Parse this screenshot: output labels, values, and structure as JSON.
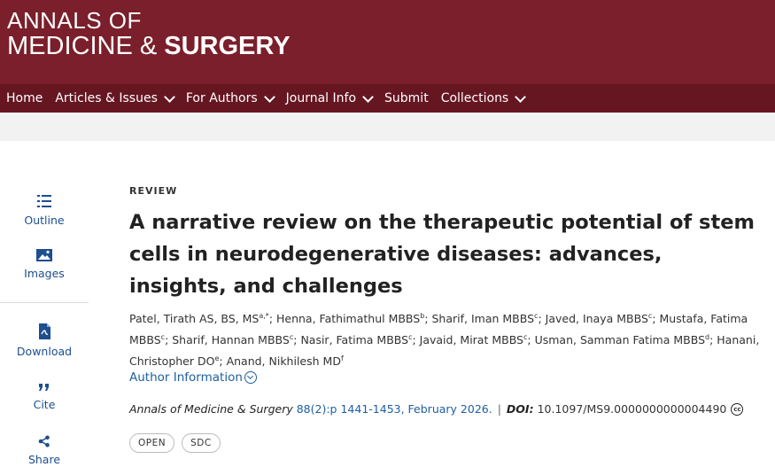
{
  "brand": {
    "line1": "ANNALS OF",
    "line2_pre": "MEDICINE & ",
    "line2_bold": "SURGERY",
    "colors": {
      "masthead": "#7a1f2b",
      "navbar": "#661621",
      "link": "#1d5fa3"
    }
  },
  "nav": [
    {
      "label": "Home",
      "dropdown": false
    },
    {
      "label": "Articles & Issues",
      "dropdown": true
    },
    {
      "label": "For Authors",
      "dropdown": true
    },
    {
      "label": "Journal Info",
      "dropdown": true
    },
    {
      "label": "Submit",
      "dropdown": false
    },
    {
      "label": "Collections",
      "dropdown": true
    }
  ],
  "sidebar": [
    {
      "label": "Outline",
      "icon": "outline-list-icon"
    },
    {
      "label": "Images",
      "icon": "image-icon"
    },
    {
      "label": "Download",
      "icon": "pdf-download-icon"
    },
    {
      "label": "Cite",
      "icon": "quote-icon"
    },
    {
      "label": "Share",
      "icon": "share-icon"
    }
  ],
  "article": {
    "type": "REVIEW",
    "title": "A narrative review on the therapeutic potential of stem cells in neurodegenerative diseases: advances, insights, and challenges",
    "authors": [
      {
        "name": "Patel, Tirath AS, BS, MS",
        "sup": "a,*"
      },
      {
        "name": "Henna, Fathimathul MBBS",
        "sup": "b"
      },
      {
        "name": "Sharif, Iman MBBS",
        "sup": "c"
      },
      {
        "name": "Javed, Inaya MBBS",
        "sup": "c"
      },
      {
        "name": "Mustafa, Fatima MBBS",
        "sup": "c"
      },
      {
        "name": "Sharif, Hannan MBBS",
        "sup": "c"
      },
      {
        "name": "Nasir, Fatima MBBS",
        "sup": "c"
      },
      {
        "name": "Javaid, Mirat MBBS",
        "sup": "c"
      },
      {
        "name": "Usman, Samman Fatima MBBS",
        "sup": "d"
      },
      {
        "name": "Hanani, Christopher DO",
        "sup": "e"
      },
      {
        "name": "Anand, Nikhilesh MD",
        "sup": "f"
      }
    ],
    "author_info_label": "Author Information",
    "journal": "Annals of Medicine & Surgery",
    "citation_link": "88(2):p 1441-1453, February 2026.",
    "doi_label": "DOI:",
    "doi": "10.1097/MS9.0000000000004490",
    "license_icon": "cc",
    "badges": [
      "OPEN",
      "SDC"
    ]
  }
}
